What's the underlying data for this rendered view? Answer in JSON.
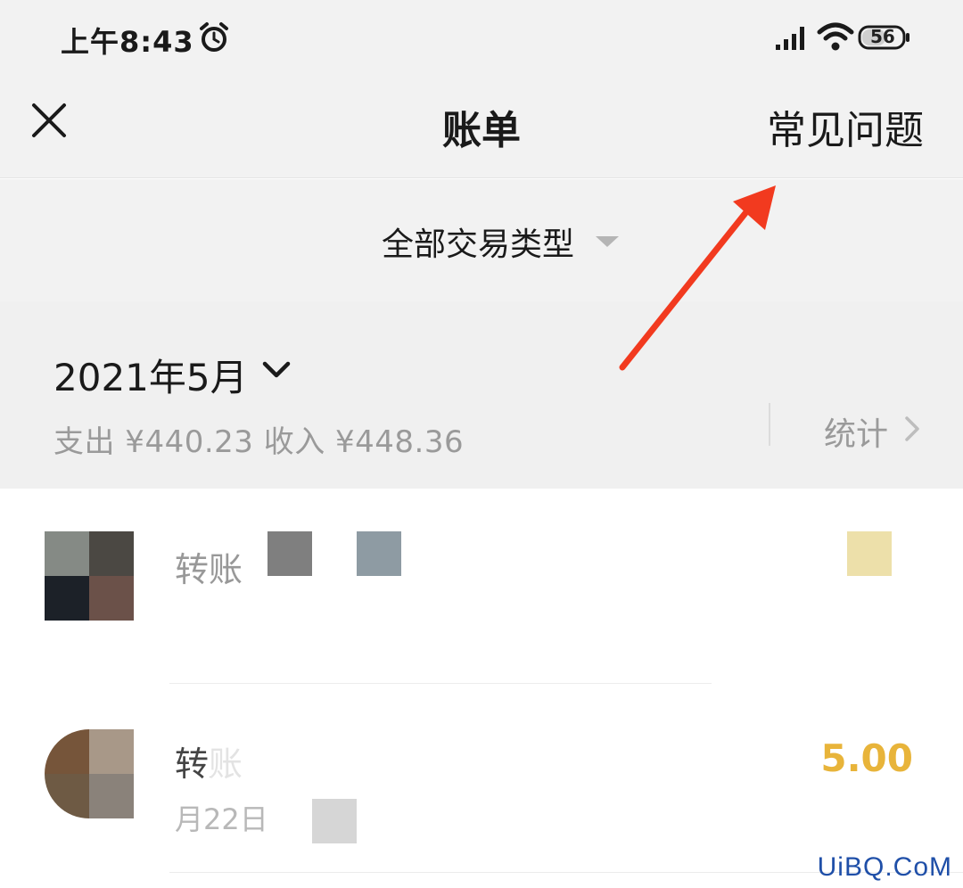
{
  "status_bar": {
    "time": "上午8:43",
    "battery": "56"
  },
  "nav": {
    "title": "账单",
    "faq": "常见问题"
  },
  "filter": {
    "label": "全部交易类型"
  },
  "month": {
    "label": "2021年5月",
    "summary": "支出 ¥440.23 收入 ¥448.36",
    "stats": "统计"
  },
  "transactions": [
    {
      "title": "转账",
      "date": "",
      "amount": ""
    },
    {
      "title": "转账",
      "date": "月22日",
      "amount": "5.00"
    }
  ],
  "annotation": {
    "arrow_color": "#f23a1f"
  },
  "watermark": {
    "text": "UiBQ.CoM"
  },
  "colors": {
    "accent_amount": "#e8b43a",
    "background": "#f2f2f2"
  }
}
